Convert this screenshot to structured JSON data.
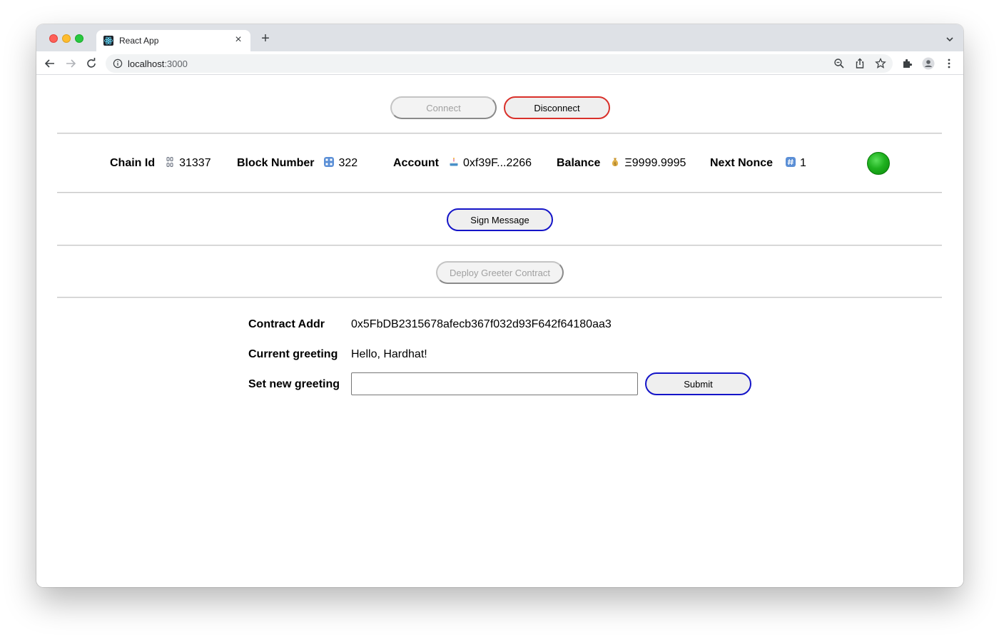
{
  "browser": {
    "tab_title": "React App",
    "url_host": "localhost",
    "url_port": ":3000"
  },
  "toolbar": {
    "connect_label": "Connect",
    "disconnect_label": "Disconnect"
  },
  "stats": {
    "chain_id_label": "Chain Id",
    "chain_id_value": "31337",
    "block_number_label": "Block Number",
    "block_number_value": "322",
    "account_label": "Account",
    "account_value": "0xf39F...2266",
    "balance_label": "Balance",
    "balance_value": "Ξ9999.9995",
    "nonce_label": "Next Nonce",
    "nonce_value": "1",
    "status_color": "#1fb11f"
  },
  "actions": {
    "sign_message_label": "Sign Message",
    "deploy_label": "Deploy Greeter Contract"
  },
  "contract": {
    "addr_label": "Contract Addr",
    "addr_value": "0x5FbDB2315678afecb367f032d93F642f64180aa3",
    "greeting_label": "Current greeting",
    "greeting_value": "Hello, Hardhat!",
    "set_label": "Set new greeting",
    "input_value": "",
    "submit_label": "Submit"
  },
  "icons": {
    "chain": "link-icon",
    "block": "numbers-icon",
    "account": "cake-icon",
    "balance": "money-bag-icon",
    "nonce": "hash-icon"
  }
}
